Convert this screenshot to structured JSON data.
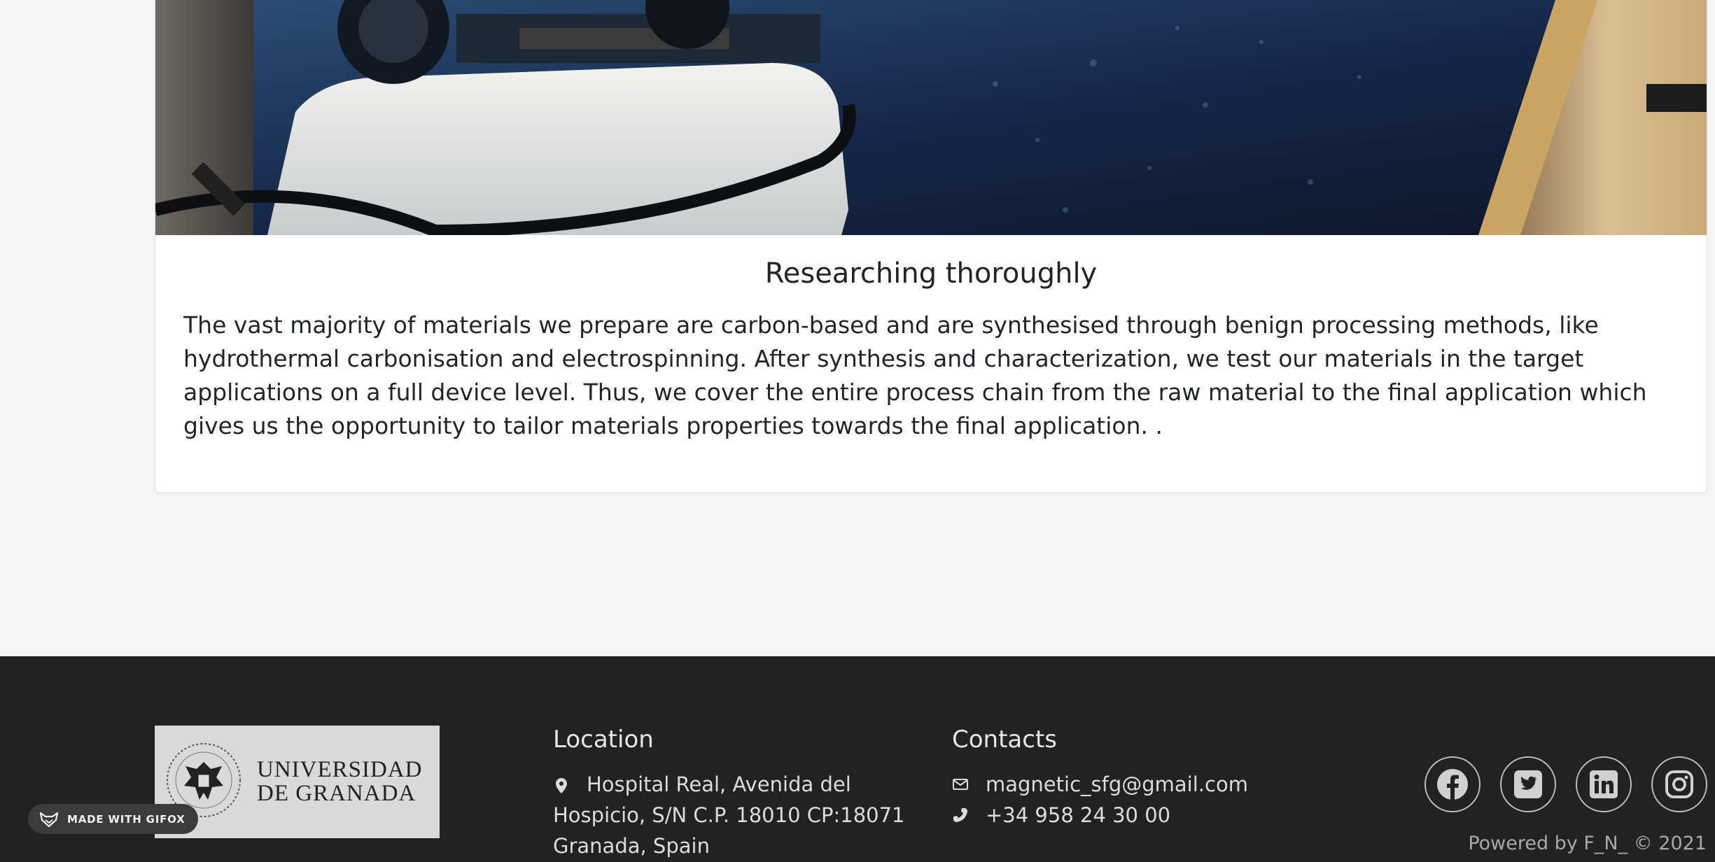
{
  "card": {
    "title": "Researching thoroughly",
    "body": "The vast majority of materials we prepare are carbon-based and are synthesised through benign processing methods, like hydrothermal carbonisation and electrospinning. After synthesis and characterization, we test our materials in the target applications on a full device level. Thus, we cover the entire process chain from the raw material to the final application which gives us the opportunity to tailor materials properties towards the final application. ."
  },
  "footer": {
    "logo": {
      "line1": "UNIVERSIDAD",
      "line2": "DE GRANADA"
    },
    "location": {
      "heading": "Location",
      "address": "Hospital Real, Avenida del Hospicio, S/N C.P. 18010 CP:18071 Granada, Spain",
      "icon": "map-marker-icon"
    },
    "contacts": {
      "heading": "Contacts",
      "email": "magnetic_sfg@gmail.com",
      "phone": "+34 958 24 30 00",
      "email_icon": "envelope-icon",
      "phone_icon": "phone-icon"
    },
    "social": [
      "facebook-icon",
      "twitter-icon",
      "linkedin-icon",
      "instagram-icon"
    ],
    "powered": "Powered by F_N_ © 2021"
  },
  "badge": {
    "label": "MADE WITH GIFOX",
    "icon": "gifox-fox-icon"
  },
  "colors": {
    "footer_bg": "#222222",
    "page_bg": "#f5f5f5"
  }
}
